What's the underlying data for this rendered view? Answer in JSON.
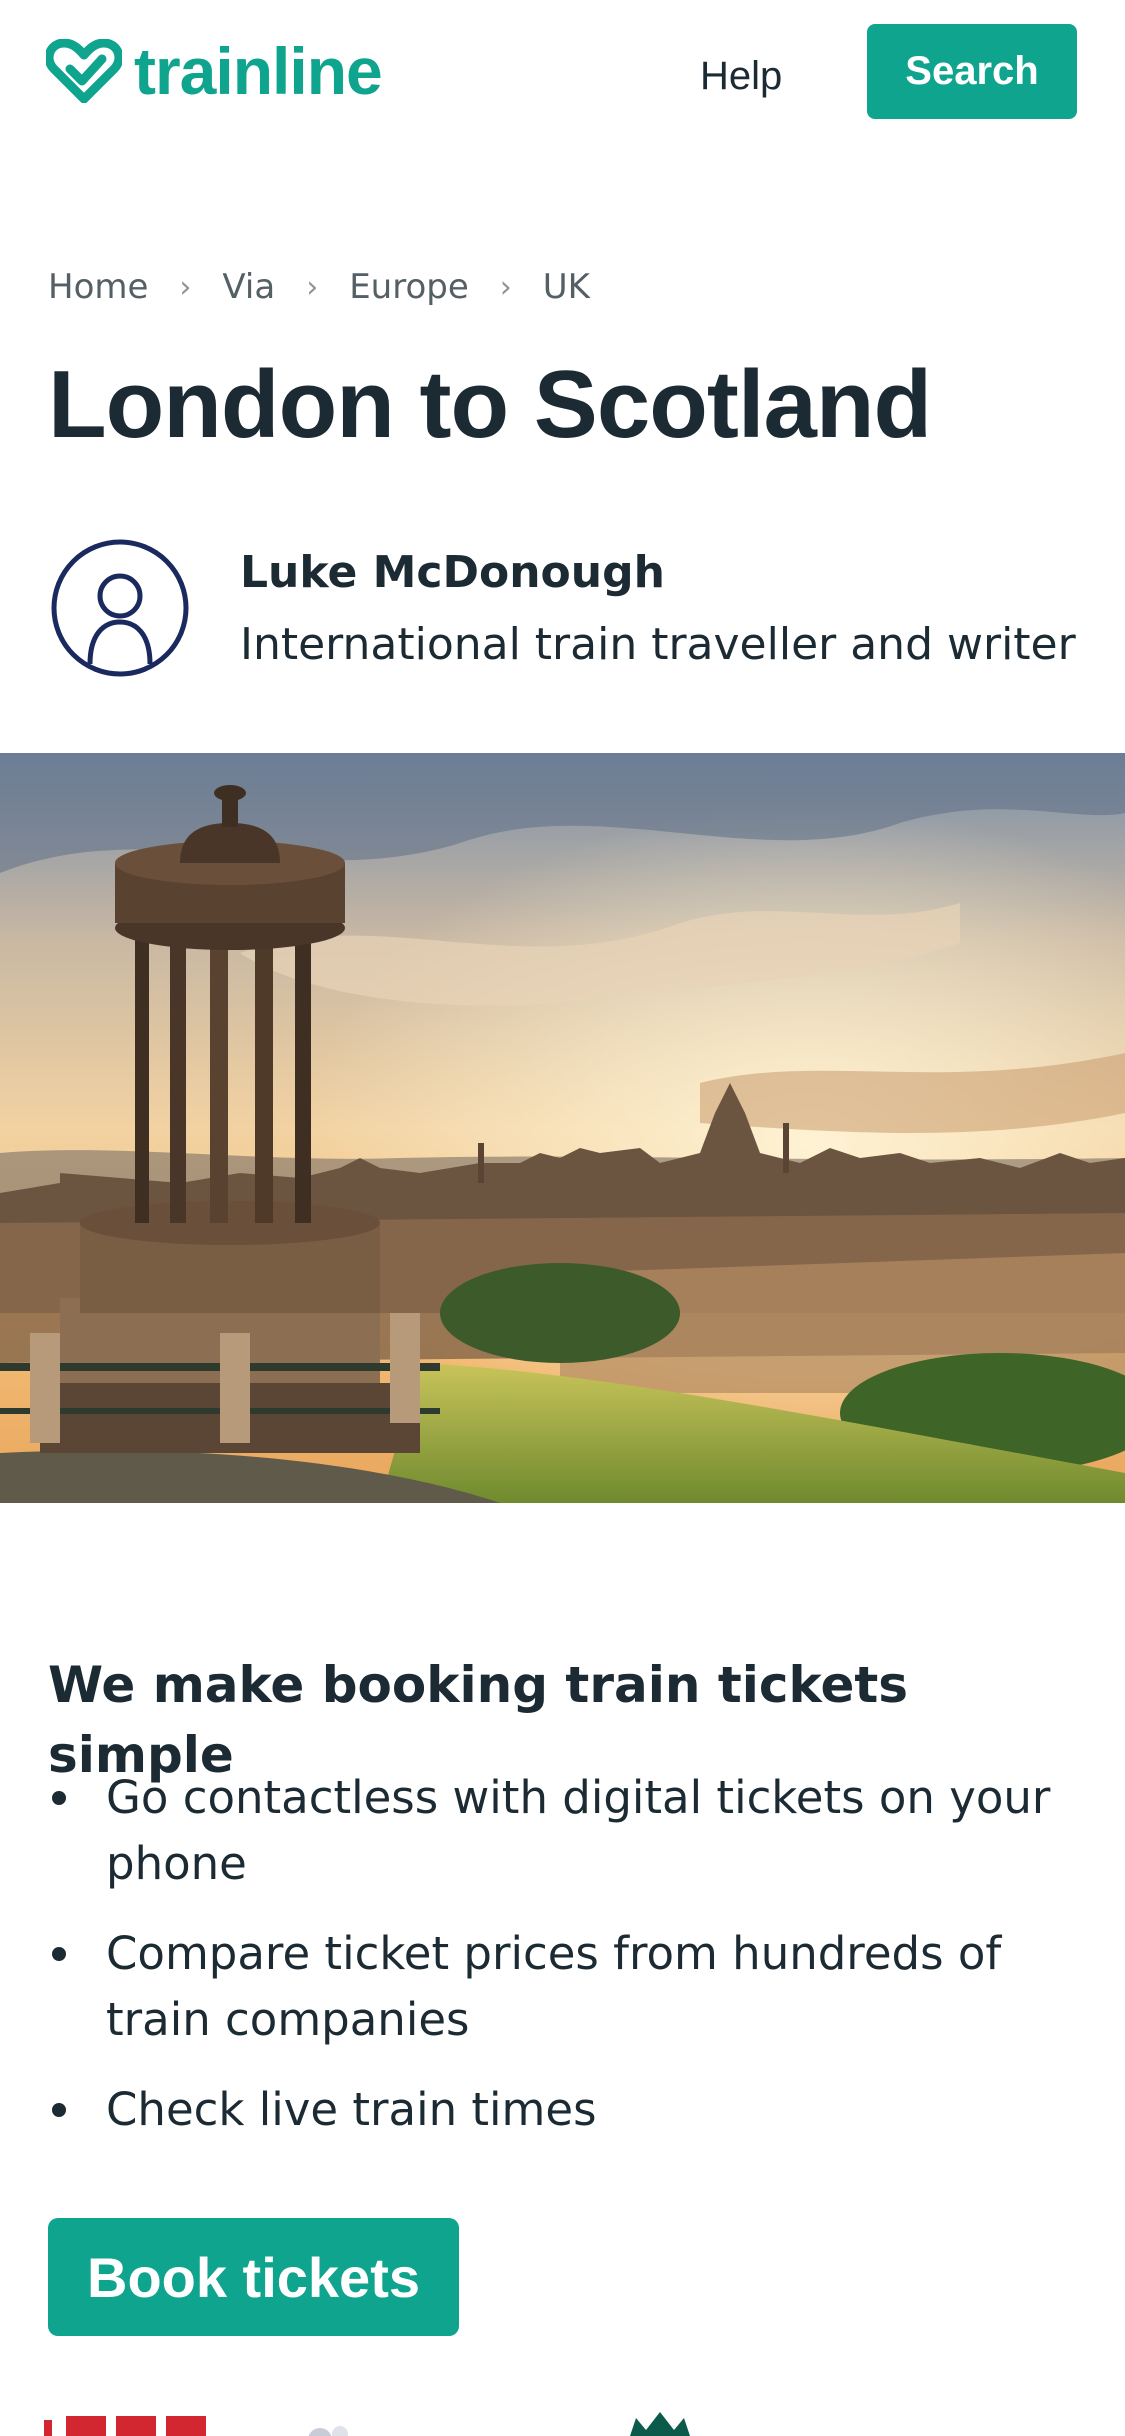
{
  "header": {
    "logo_text": "trainline",
    "help_label": "Help",
    "search_label": "Search"
  },
  "breadcrumb": {
    "items": [
      "Home",
      "Via",
      "Europe",
      "UK"
    ],
    "separator": "›"
  },
  "page": {
    "title": "London to Scotland"
  },
  "author": {
    "name": "Luke McDonough",
    "role": "International train traveller and writer"
  },
  "benefits": {
    "title": "We make booking train tickets simple",
    "items": [
      "Go contactless with digital tickets on your phone",
      "Compare ticket prices from hundreds of train companies",
      "Check live train times"
    ]
  },
  "cta": {
    "book_label": "Book tickets"
  },
  "colors": {
    "brand": "#0fa48d",
    "text": "#1b2a33",
    "muted": "#555f66",
    "avatar_stroke": "#1a2a5e",
    "lner_red": "#d22630"
  },
  "icons": {
    "logo": "trainline-heart-check-icon",
    "avatar": "user-avatar-icon",
    "separator": "chevron-right-icon"
  }
}
